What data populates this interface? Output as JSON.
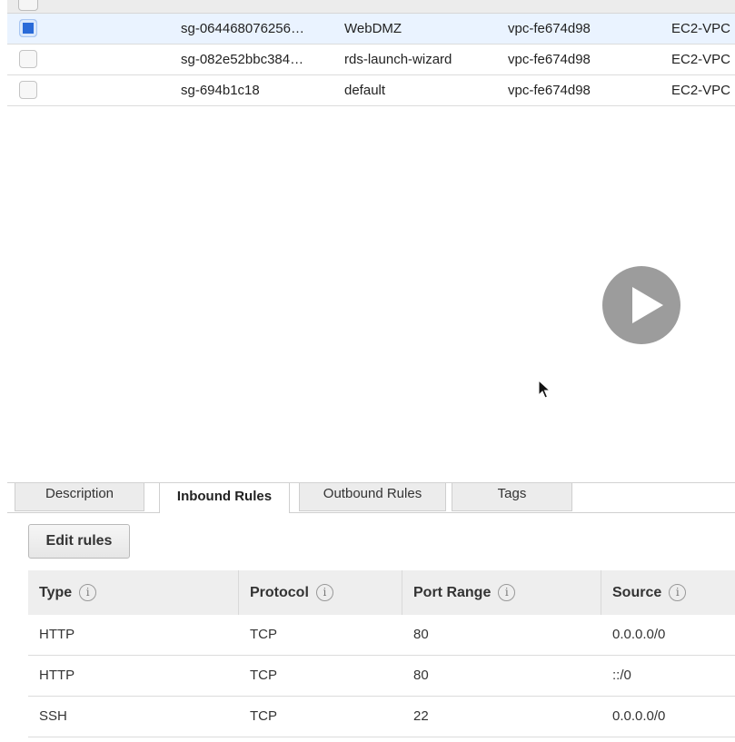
{
  "security_groups": [
    {
      "id": "sg-064468076256…",
      "name": "WebDMZ",
      "vpc": "vpc-fe674d98",
      "type": "EC2-VPC",
      "selected": true
    },
    {
      "id": "sg-082e52bbc384…",
      "name": "rds-launch-wizard",
      "vpc": "vpc-fe674d98",
      "type": "EC2-VPC",
      "selected": false
    },
    {
      "id": "sg-694b1c18",
      "name": "default",
      "vpc": "vpc-fe674d98",
      "type": "EC2-VPC",
      "selected": false
    }
  ],
  "tabs": [
    {
      "label": "Description",
      "active": false
    },
    {
      "label": "Inbound Rules",
      "active": true
    },
    {
      "label": "Outbound Rules",
      "active": false
    },
    {
      "label": "Tags",
      "active": false
    }
  ],
  "edit_button_label": "Edit rules",
  "rules_table": {
    "headers": [
      "Type",
      "Protocol",
      "Port Range",
      "Source"
    ],
    "info_glyph": "i",
    "rows": [
      [
        "HTTP",
        "TCP",
        "80",
        "0.0.0.0/0"
      ],
      [
        "HTTP",
        "TCP",
        "80",
        "::/0"
      ],
      [
        "SSH",
        "TCP",
        "22",
        "0.0.0.0/0"
      ]
    ]
  },
  "icons": {
    "play": "play-icon",
    "cursor": "mouse-cursor-icon",
    "info": "info-icon"
  },
  "colors": {
    "selected_row": "#eaf3ff",
    "checkbox_checked": "#2a6ad8",
    "play_overlay": "#9c9c9c"
  }
}
